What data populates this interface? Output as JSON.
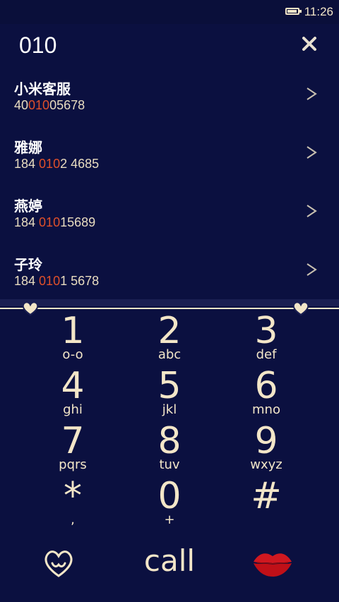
{
  "status_bar": {
    "time": "11:26"
  },
  "dialer": {
    "dialed_number": "010"
  },
  "contacts": [
    {
      "name": "小米客服",
      "number_pre": "40",
      "number_match": "010",
      "number_post": "05678"
    },
    {
      "name": "雅娜",
      "number_pre": "184 ",
      "number_match": "010",
      "number_post": "2 4685"
    },
    {
      "name": "燕婷",
      "number_pre": "184 ",
      "number_match": "010",
      "number_post": "15689"
    },
    {
      "name": "子玲",
      "number_pre": "184 ",
      "number_match": "010",
      "number_post": "1 5678"
    }
  ],
  "keypad": [
    {
      "digit": "1",
      "letters": "o-o"
    },
    {
      "digit": "2",
      "letters": "abc"
    },
    {
      "digit": "3",
      "letters": "def"
    },
    {
      "digit": "4",
      "letters": "ghi"
    },
    {
      "digit": "5",
      "letters": "jkl"
    },
    {
      "digit": "6",
      "letters": "mno"
    },
    {
      "digit": "7",
      "letters": "pqrs"
    },
    {
      "digit": "8",
      "letters": "tuv"
    },
    {
      "digit": "9",
      "letters": "wxyz"
    },
    {
      "digit": "*",
      "letters": ","
    },
    {
      "digit": "0",
      "letters": "+"
    },
    {
      "digit": "#",
      "letters": ""
    }
  ],
  "actions": {
    "call_label": "call"
  },
  "colors": {
    "background": "#0b1040",
    "text": "#f3e6c8",
    "highlight": "#e0502a",
    "lips": "#d01820"
  },
  "icons": [
    "battery-icon",
    "clear-icon",
    "chevron-right-icon",
    "heart-icon",
    "heart-contacts-icon",
    "lips-icon"
  ]
}
